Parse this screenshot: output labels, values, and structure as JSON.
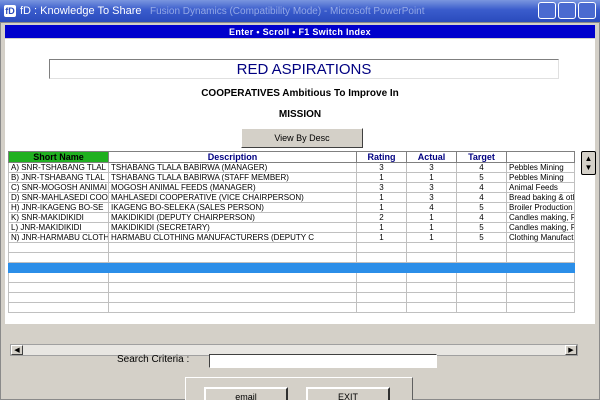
{
  "window": {
    "title": "fD : Knowledge To Share",
    "app_icon": "fD",
    "ghost_title": "Fusion Dynamics (Compatibility Mode) - Microsoft PowerPoint"
  },
  "keybar": {
    "text": "Enter  •  Scroll  •  F1 Switch Index"
  },
  "header": {
    "org_name": "RED ASPIRATIONS",
    "subtitle": "COOPERATIVES Ambitious To Improve In",
    "mission": "MISSION",
    "view_button": "View By Desc"
  },
  "grid": {
    "columns": [
      "Short Name",
      "Description",
      "Rating",
      "Actual",
      "Target",
      ""
    ],
    "rows": [
      [
        "A) SNR-TSHABANG TLAL",
        "TSHABANG TLALA BABIRWA (MANAGER)",
        "3",
        "3",
        "4",
        "Pebbles Mining"
      ],
      [
        "B) JNR-TSHABANG TLAL",
        "TSHABANG TLALA BABIRWA (STAFF MEMBER)",
        "1",
        "1",
        "5",
        "Pebbles Mining"
      ],
      [
        "C) SNR-MOGOSH ANIMAI",
        "MOGOSH ANIMAL FEEDS (MANAGER)",
        "3",
        "3",
        "4",
        "Animal Feeds"
      ],
      [
        "D) SNR-MAHLASEDI COO",
        "MAHLASEDI COOPERATIVE (VICE CHAIRPERSON)",
        "1",
        "3",
        "4",
        "Bread baking & oth"
      ],
      [
        "H) JNR-IKAGENG BO-SE",
        "IKAGENG BO-SELEKA (SALES PERSON)",
        "1",
        "4",
        "5",
        "Broiler Production"
      ],
      [
        "K) SNR-MAKIDIKIDI",
        "MAKIDIKIDI (DEPUTY CHAIRPERSON)",
        "2",
        "1",
        "4",
        "Candles making, Fe"
      ],
      [
        "L) JNR-MAKIDIKIDI",
        "MAKIDIKIDI (SECRETARY)",
        "1",
        "1",
        "5",
        "Candles making, Fe"
      ],
      [
        "N) JNR-HARMABU CLOTH",
        "HARMABU CLOTHING MANUFACTURERS (DEPUTY C",
        "1",
        "1",
        "5",
        "Clothing Manufactu"
      ]
    ],
    "blank_rows_before_selected": 2,
    "blank_rows_after_selected": 4,
    "selected_color": "#2b8ee8"
  },
  "search": {
    "label": "Search  Criteria :",
    "value": ""
  },
  "buttons": {
    "email": "email",
    "exit": "EXIT"
  },
  "colors": {
    "key_bar": "#0000cc",
    "short_name_header": "#20b020",
    "header_text": "#000080"
  }
}
